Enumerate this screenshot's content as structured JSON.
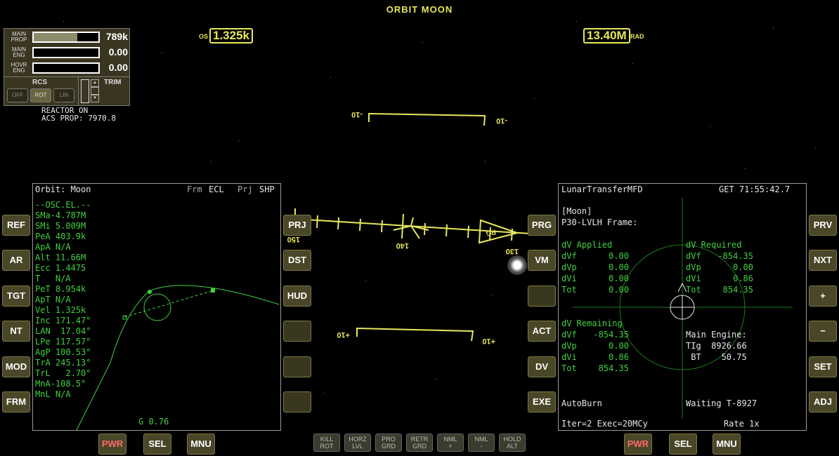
{
  "hud": {
    "title": "ORBIT MOON",
    "os_label": "OS",
    "os_value": "1.325k",
    "rad_value": "13.40M",
    "rad_label": "RAD",
    "ladder_top_left": "-10",
    "ladder_top_right": "-10",
    "ladder_bottom_left": "+10",
    "ladder_bottom_right": "+10",
    "heading_150": "150",
    "heading_140": "140",
    "heading_130": "130",
    "prograde_marker": "PG"
  },
  "engines": {
    "main_prop_label": "MAIN PROP",
    "main_prop_value": "789k",
    "main_prop_level": 0.67,
    "main_eng_label": "MAIN ENG",
    "main_eng_value": "0.00",
    "hovr_eng_label": "HOVR ENG",
    "hovr_eng_value": "0.00",
    "rcs_label": "RCS",
    "rcs_off": "OFF",
    "rcs_rot": "ROT",
    "rcs_lin": "LIN",
    "trim_label": "TRIM"
  },
  "status": {
    "line1": "REACTOR ON",
    "line2": "ACS PROP: 7970.8"
  },
  "left_buttons": [
    "REF",
    "AR",
    "TGT",
    "NT",
    "MOD",
    "FRM"
  ],
  "left_inner_buttons": [
    "PRJ",
    "DST",
    "HUD",
    "",
    "",
    ""
  ],
  "right_inner_buttons": [
    "PRG",
    "VM",
    "",
    "ACT",
    "DV",
    "EXE"
  ],
  "right_buttons": [
    "PRV",
    "NXT",
    "+",
    "−",
    "SET",
    "ADJ"
  ],
  "left_bottom": {
    "pwr": "PWR",
    "sel": "SEL",
    "mnu": "MNU"
  },
  "right_bottom": {
    "pwr": "PWR",
    "sel": "SEL",
    "mnu": "MNU"
  },
  "nav_buttons": [
    {
      "l1": "KILL",
      "l2": "ROT"
    },
    {
      "l1": "HORZ",
      "l2": "LVL"
    },
    {
      "l1": "PRO",
      "l2": "GRD"
    },
    {
      "l1": "RETR",
      "l2": "GRD"
    },
    {
      "l1": "NML",
      "l2": "+"
    },
    {
      "l1": "NML",
      "l2": "-"
    },
    {
      "l1": "HOLD",
      "l2": "ALT"
    }
  ],
  "orbit_mfd": {
    "title": "Orbit: Moon",
    "frm_label": "Frm",
    "frm_value": "ECL",
    "prj_label": "Prj",
    "prj_value": "SHP",
    "header": "--OSC.EL.--",
    "elements": [
      "SMa-4.787M",
      "SMi 5.009M",
      "PeA 403.9k",
      "ApA N/A",
      "Alt 11.66M",
      "Ecc 1.4475",
      "T   N/A",
      "PeT 8.954k",
      "ApT N/A",
      "Vel 1.325k",
      "Inc 171.47°",
      "LAN  17.04°",
      "LPe 117.57°",
      "AgP 100.53°",
      "TrA 245.13°",
      "TrL   2.70°",
      "MnA-108.5°",
      "MnL N/A"
    ],
    "g_value": "G 0.76"
  },
  "lt_mfd": {
    "title": "LunarTransferMFD",
    "get": "GET 71:55:42.7",
    "body": "[Moon]",
    "frame": "P30-LVLH Frame:",
    "applied_header": "dV Applied",
    "applied": [
      {
        "k": "dVf",
        "v": "0.00"
      },
      {
        "k": "dVp",
        "v": "0.00"
      },
      {
        "k": "dVi",
        "v": "0.00"
      },
      {
        "k": "Tot",
        "v": "0.00"
      }
    ],
    "required_header": "dV Required",
    "required": [
      {
        "k": "dVf",
        "v": "-854.35"
      },
      {
        "k": "dVp",
        "v": "0.00"
      },
      {
        "k": "dVi",
        "v": "0.86"
      },
      {
        "k": "Tot",
        "v": "854.35"
      }
    ],
    "remaining_header": "dV Remaining",
    "remaining": [
      {
        "k": "dVf",
        "v": "-854.35"
      },
      {
        "k": "dVp",
        "v": "0.00"
      },
      {
        "k": "dVi",
        "v": "0.86"
      },
      {
        "k": "Tot",
        "v": "854.35"
      }
    ],
    "main_engine_header": "Main Engine:",
    "tig": "TIg  8926.66",
    "bt": " BT    50.75",
    "autoburn": "AutoBurn",
    "waiting": "Waiting T-8927",
    "iter": "Iter=2 Exec=20MCy",
    "rate": "Rate 1x"
  }
}
